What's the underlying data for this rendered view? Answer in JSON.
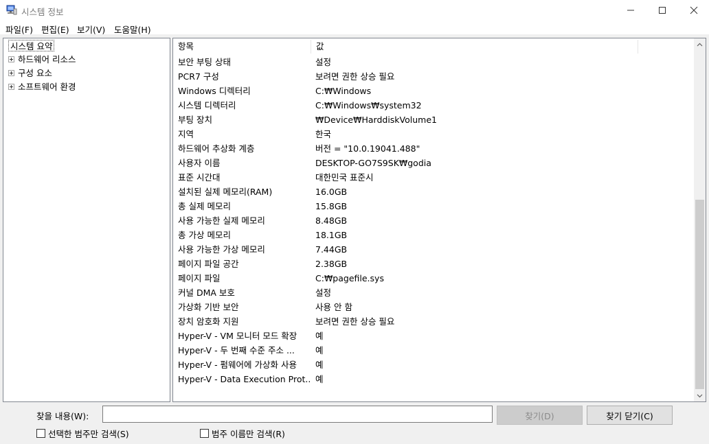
{
  "window": {
    "title": "시스템 정보",
    "icons": {
      "app": "system-info-icon",
      "minimize": "minimize-icon",
      "maximize": "maximize-icon",
      "close": "close-icon"
    }
  },
  "menu": [
    "파일(F)",
    "편집(E)",
    "보기(V)",
    "도움말(H)"
  ],
  "tree": {
    "root": "시스템 요약",
    "children": [
      "하드웨어 리소스",
      "구성 요소",
      "소프트웨어 환경"
    ]
  },
  "table": {
    "headers": {
      "item": "항목",
      "value": "값"
    },
    "rows": [
      {
        "item": "보안 부팅 상태",
        "value": "설정"
      },
      {
        "item": "PCR7 구성",
        "value": "보려면 권한 상승 필요"
      },
      {
        "item": "Windows 디렉터리",
        "value": "C:₩Windows"
      },
      {
        "item": "시스템 디렉터리",
        "value": "C:₩Windows₩system32"
      },
      {
        "item": "부팅 장치",
        "value": "₩Device₩HarddiskVolume1"
      },
      {
        "item": "지역",
        "value": "한국"
      },
      {
        "item": "하드웨어 추상화 계층",
        "value": "버전 = \"10.0.19041.488\""
      },
      {
        "item": "사용자 이름",
        "value": "DESKTOP-GO7S9SK₩godia"
      },
      {
        "item": "표준 시간대",
        "value": "대한민국 표준시"
      },
      {
        "item": "설치된 실제 메모리(RAM)",
        "value": "16.0GB"
      },
      {
        "item": "총 실제 메모리",
        "value": "15.8GB"
      },
      {
        "item": "사용 가능한 실제 메모리",
        "value": "8.48GB"
      },
      {
        "item": "총 가상 메모리",
        "value": "18.1GB"
      },
      {
        "item": "사용 가능한 가상 메모리",
        "value": "7.44GB"
      },
      {
        "item": "페이지 파일 공간",
        "value": "2.38GB"
      },
      {
        "item": "페이지 파일",
        "value": "C:₩pagefile.sys"
      },
      {
        "item": "커널 DMA 보호",
        "value": "설정"
      },
      {
        "item": "가상화 기반 보안",
        "value": "사용 안 함"
      },
      {
        "item": "장치 암호화 지원",
        "value": "보려면 권한 상승 필요"
      },
      {
        "item": "Hyper-V - VM 모니터 모드 확장",
        "value": "예"
      },
      {
        "item": "Hyper-V - 두 번째 수준 주소 ...",
        "value": "예"
      },
      {
        "item": "Hyper-V - 펌웨어에 가상화 사용",
        "value": "예"
      },
      {
        "item": "Hyper-V - Data Execution Prot...",
        "value": "예"
      }
    ]
  },
  "find": {
    "label": "찾을 내용(W):",
    "value": "",
    "find_button": "찾기(D)",
    "close_find_button": "찾기 닫기(C)",
    "checkbox_selected_category": "선택한 범주만 검색(S)",
    "checkbox_category_names": "범주 이름만 검색(R)"
  }
}
